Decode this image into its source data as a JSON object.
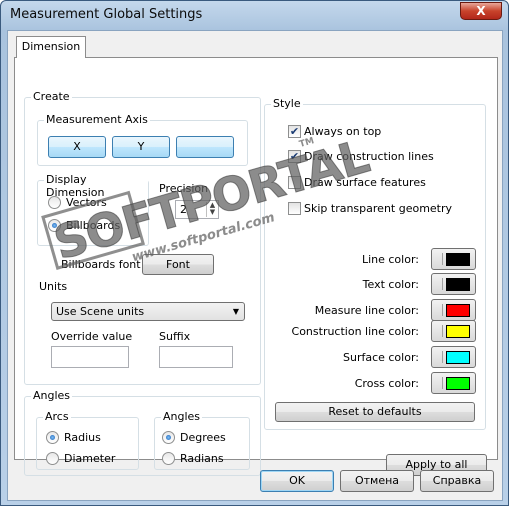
{
  "window": {
    "title": "Measurement Global Settings",
    "close_glyph": "X"
  },
  "tabs": [
    {
      "label": "Dimension"
    }
  ],
  "create": {
    "label": "Create",
    "axis": {
      "label": "Measurement Axis",
      "buttons": [
        "X",
        "Y",
        ""
      ]
    },
    "display": {
      "label": "Display Dimension",
      "options": [
        {
          "label": "Vectors",
          "selected": false
        },
        {
          "label": "Billboards",
          "selected": true
        }
      ],
      "precision_label": "Precision",
      "precision_value": "2"
    },
    "billboards_font_label": "Billboards font",
    "font_button": "Font",
    "units": {
      "label": "Units",
      "selected": "Use Scene units",
      "override_label": "Override value",
      "override_value": "",
      "suffix_label": "Suffix",
      "suffix_value": ""
    }
  },
  "angles": {
    "label": "Angles",
    "arcs": {
      "label": "Arcs",
      "options": [
        {
          "label": "Radius",
          "selected": true
        },
        {
          "label": "Diameter",
          "selected": false
        }
      ]
    },
    "units": {
      "label": "Angles",
      "options": [
        {
          "label": "Degrees",
          "selected": true
        },
        {
          "label": "Radians",
          "selected": false
        }
      ]
    }
  },
  "style": {
    "label": "Style",
    "checks": [
      {
        "label": "Always on top",
        "checked": true
      },
      {
        "label": "Draw construction lines",
        "checked": true
      },
      {
        "label": "Draw surface features",
        "checked": false
      },
      {
        "label": "Skip transparent geometry",
        "checked": false
      }
    ],
    "colors": [
      {
        "label": "Line color:",
        "color": "#000000"
      },
      {
        "label": "Text color:",
        "color": "#000000"
      },
      {
        "label": "Measure line color:",
        "color": "#ff0000"
      },
      {
        "label": "Construction line color:",
        "color": "#ffff00"
      },
      {
        "label": "Surface color:",
        "color": "#00ffff"
      },
      {
        "label": "Cross color:",
        "color": "#00ff00"
      }
    ],
    "reset_button": "Reset to defaults"
  },
  "apply_all_button": "Apply to all",
  "footer": {
    "ok": "OK",
    "cancel": "Отмена",
    "help": "Справка"
  },
  "watermark": {
    "brand": "SOFTPORTAL",
    "url": "www.softportal.com",
    "tm": "TM"
  }
}
